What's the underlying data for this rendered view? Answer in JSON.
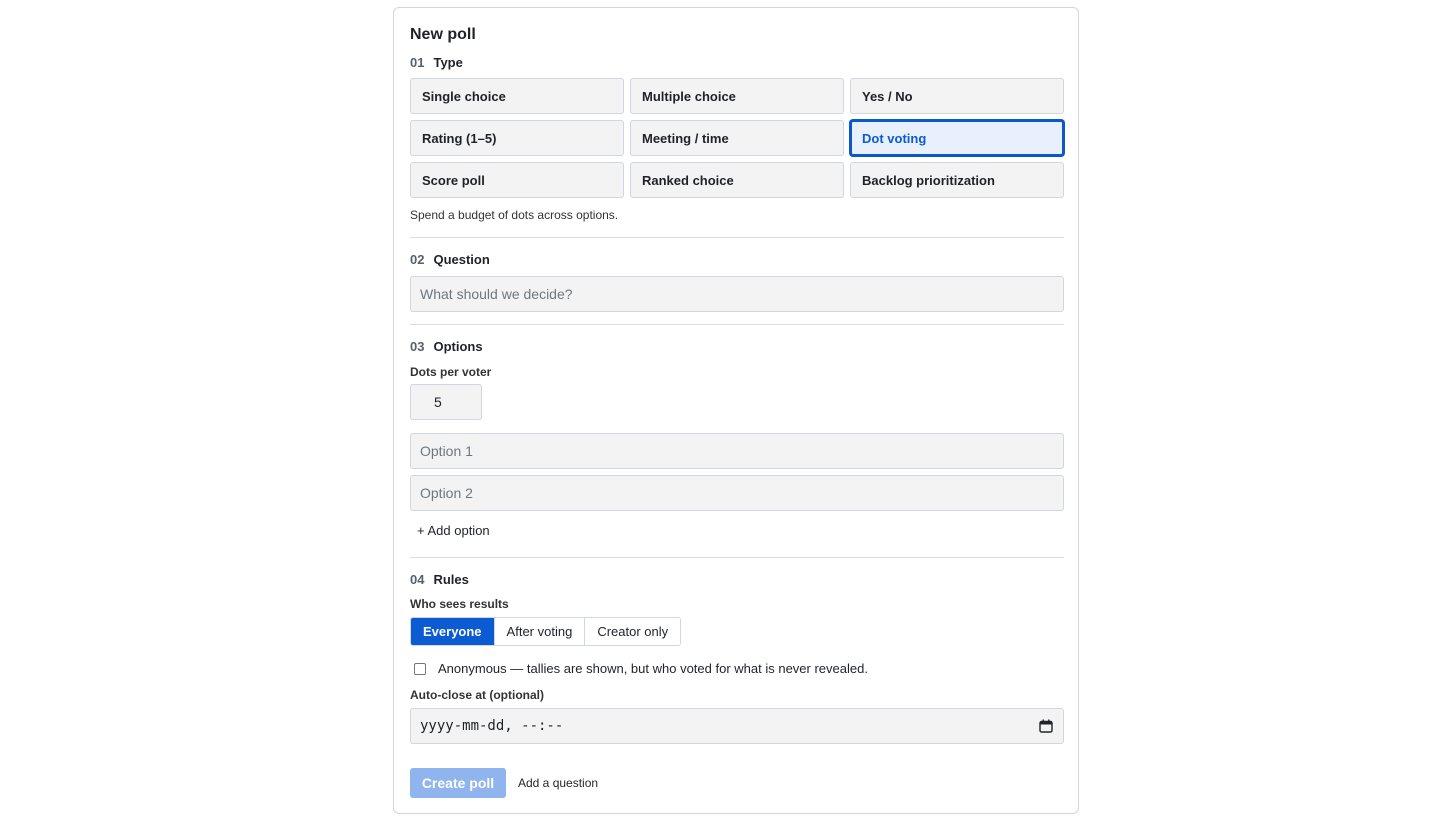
{
  "form": {
    "title": "New poll",
    "type_section": {
      "num": "01",
      "label": "Type"
    },
    "types": [
      {
        "label": "Single choice"
      },
      {
        "label": "Multiple choice"
      },
      {
        "label": "Yes / No"
      },
      {
        "label": "Rating (1–5)"
      },
      {
        "label": "Meeting / time"
      },
      {
        "label": "Dot voting",
        "selected": true
      },
      {
        "label": "Score poll"
      },
      {
        "label": "Ranked choice"
      },
      {
        "label": "Backlog prioritization"
      }
    ],
    "type_help": "Spend a budget of dots across options.",
    "question_section": {
      "num": "02",
      "label": "Question"
    },
    "question_placeholder": "What should we decide?",
    "options_section": {
      "num": "03",
      "label": "Options"
    },
    "dots_label": "Dots per voter",
    "dots_value": "5",
    "option_placeholders": [
      "Option 1",
      "Option 2"
    ],
    "add_option": "+ Add option",
    "rules_section": {
      "num": "04",
      "label": "Rules"
    },
    "results_label": "Who sees results",
    "results_options": [
      "Everyone",
      "After voting",
      "Creator only"
    ],
    "results_selected": "Everyone",
    "anonymous_label": "Anonymous — tallies are shown, but who voted for what is never revealed.",
    "anonymous_checked": false,
    "autoclose_label": "Auto-close at (optional)",
    "autoclose_placeholder": "yyyy-mm-dd, --:--",
    "create_button": "Create poll",
    "add_question": "Add a question"
  },
  "colors": {
    "accent": "#0b5bd3",
    "disabled_button": "#8fb4ee",
    "field_bg": "#f3f3f3"
  }
}
